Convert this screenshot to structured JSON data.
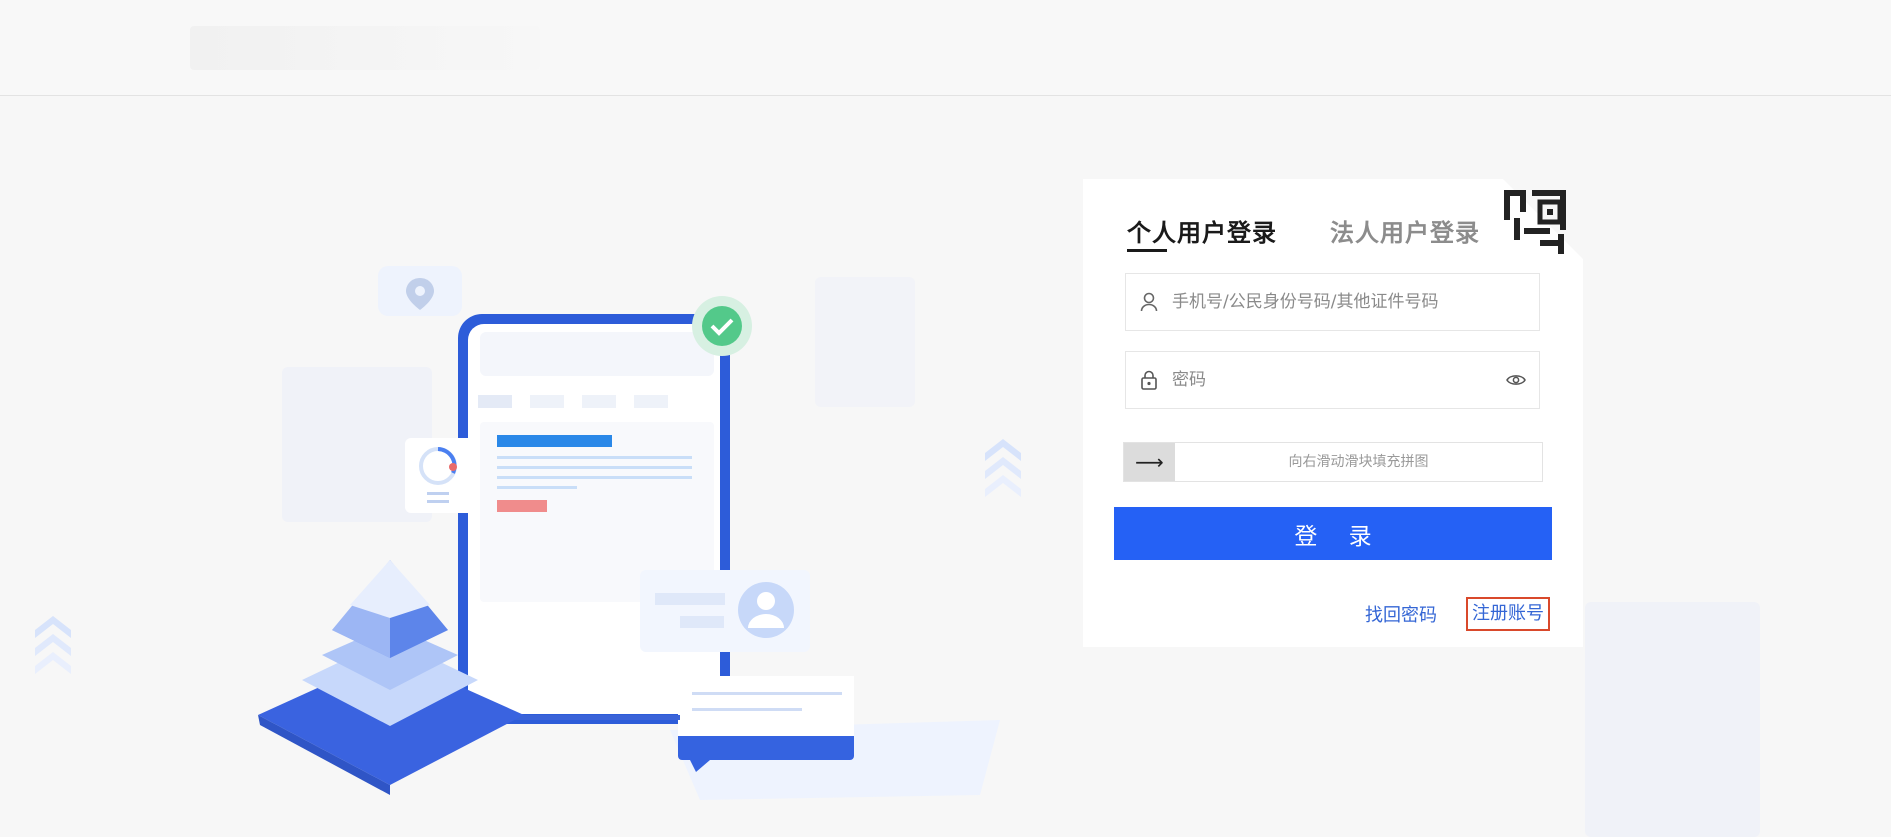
{
  "tabs": {
    "personal": "个人用户登录",
    "corporate": "法人用户登录"
  },
  "fields": {
    "account_placeholder": "手机号/公民身份号码/其他证件号码",
    "password_placeholder": "密码"
  },
  "slider": {
    "handle_glyph": "⟶",
    "hint": "向右滑动滑块填充拼图"
  },
  "buttons": {
    "login": "登 录",
    "find_password": "找回密码",
    "register": "注册账号"
  },
  "colors": {
    "primary": "#2561f5",
    "link": "#3466d5",
    "highlight_border": "#d9492b"
  },
  "icons": {
    "user": "user-icon",
    "lock": "lock-icon",
    "eye": "eye-icon",
    "qr": "qr-code-icon",
    "arrow": "arrow-right-icon"
  }
}
